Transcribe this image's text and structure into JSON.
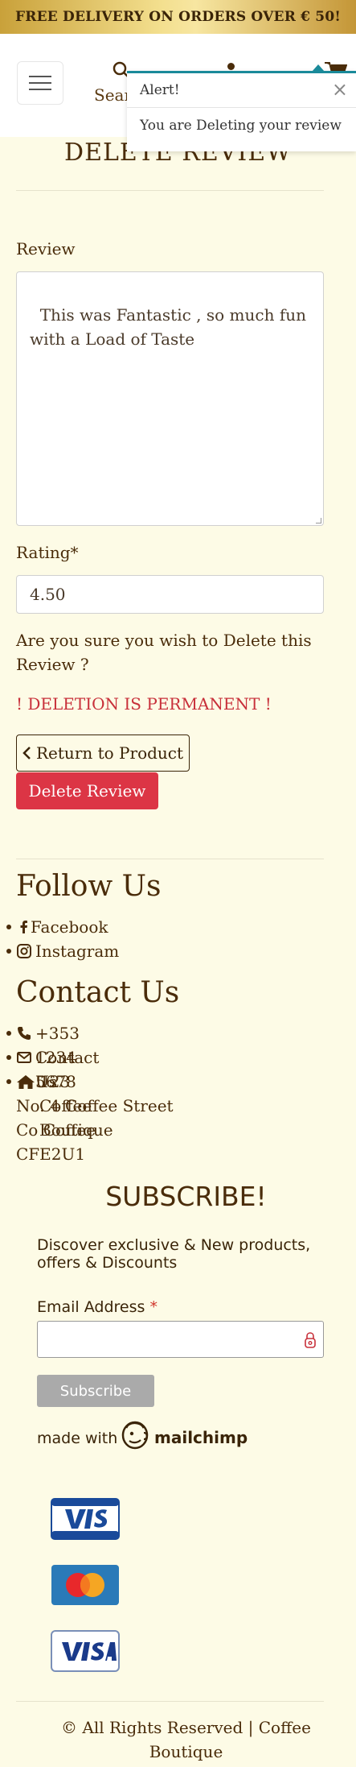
{
  "banner": {
    "text": "FREE DELIVERY ON ORDERS OVER € 50!"
  },
  "header": {
    "search_label": "Sear"
  },
  "toast": {
    "title": "Alert!",
    "close": "×",
    "message": "You are Deleting your review"
  },
  "page": {
    "title": "DELETE REVIEW"
  },
  "form": {
    "review_label": "Review",
    "review_value": "This was Fantastic , so much fun\nwith a Load of Taste",
    "rating_label": "Rating*",
    "rating_value": "4.50",
    "confirm_text": "Are you sure you wish to Delete this Review ?",
    "warning_text": "! DELETION IS PERMANENT !",
    "return_label": "Return to Product",
    "delete_label": "Delete Review"
  },
  "footer": {
    "follow_title": "Follow Us",
    "follow_items": [
      {
        "label": "Facebook",
        "icon": "facebook-icon"
      },
      {
        "label": "Instagram",
        "icon": "instagram-icon"
      }
    ],
    "contact_title": "Contact Us",
    "contact_items": [
      {
        "label": "+353 1234 5678",
        "icon": "phone-icon"
      },
      {
        "label": "Contact Us",
        "icon": "envelope-icon"
      },
      {
        "label": "123 Coffee Boutique",
        "icon": "home-icon"
      }
    ],
    "address_lines": [
      "No. 4 Coffee Street",
      "Co Coffee",
      "CFE2U1"
    ]
  },
  "subscribe": {
    "title": "SUBSCRIBE!",
    "description": "Discover exclusive & New products, offers & Discounts",
    "email_label": "Email Address",
    "required_mark": "*",
    "button_label": "Subscribe",
    "made_with": "made with",
    "brand": "mailchimp"
  },
  "payment_cards": [
    "visa-electron",
    "mastercard",
    "visa"
  ],
  "copyright": "© All Rights Reserved | Coffee Boutique",
  "colors": {
    "background": "#fdfbe6",
    "brown": "#4a2c0a",
    "danger": "#dc3545",
    "toast_accent": "#1a8a9a"
  }
}
